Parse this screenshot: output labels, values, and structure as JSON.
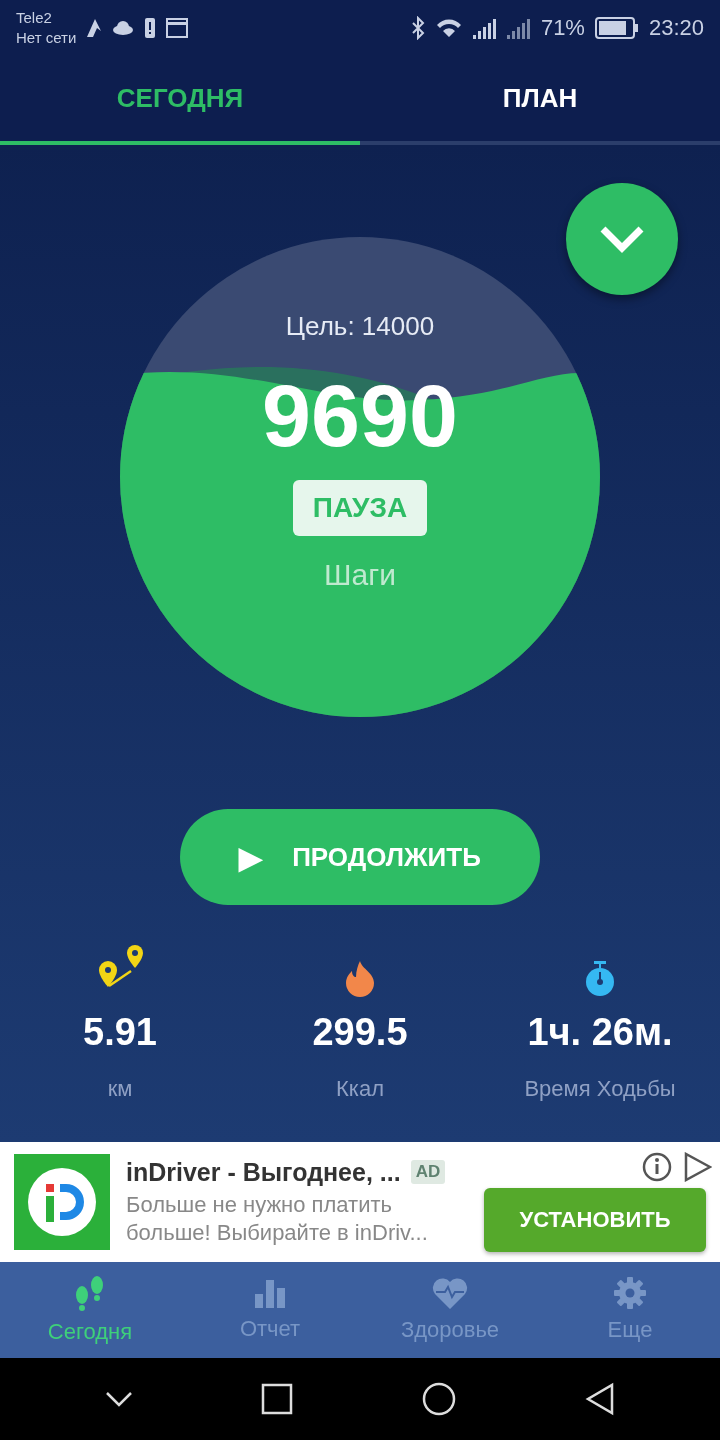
{
  "status_bar": {
    "carrier": "Tele2",
    "network": "Нет сети",
    "battery": "71%",
    "time": "23:20"
  },
  "tabs": [
    {
      "label": "СЕГОДНЯ",
      "selected": true
    },
    {
      "label": "ПЛАН",
      "selected": false
    }
  ],
  "progress": {
    "goal": "Цель: 14000",
    "steps": "9690",
    "pause": "ПАУЗА",
    "unit": "Шаги"
  },
  "continue_button": {
    "icon": "▶",
    "label": "ПРОДОЛЖИТЬ"
  },
  "stats": [
    {
      "kind": "distance",
      "value": "5.91",
      "unit": "км"
    },
    {
      "kind": "calories",
      "value": "299.5",
      "unit": "Ккал"
    },
    {
      "kind": "time",
      "value": "1ч. 26м.",
      "unit": "Время Ходьбы"
    }
  ],
  "ad": {
    "title": "inDriver - Выгоднее, ...",
    "badge": "AD",
    "text": "Больше не нужно платить больше! Выбирайте в inDriv...",
    "button": "УСТАНОВИТЬ"
  },
  "bottom_nav": [
    {
      "kind": "steps",
      "label": "Сегодня",
      "selected": true
    },
    {
      "kind": "report",
      "label": "Отчет",
      "selected": false
    },
    {
      "kind": "health",
      "label": "Здоровье",
      "selected": false
    },
    {
      "kind": "more",
      "label": "Еще",
      "selected": false
    }
  ]
}
